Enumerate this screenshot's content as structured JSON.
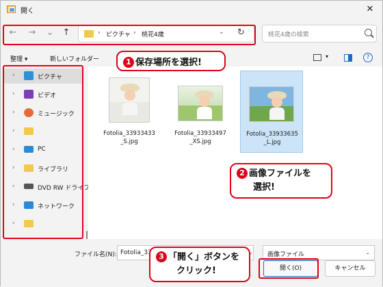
{
  "window": {
    "title": "開く",
    "close_glyph": "✕"
  },
  "nav": {
    "back": "←",
    "forward": "→",
    "recent": "⌄",
    "up": "↑"
  },
  "address": {
    "segments": [
      "ピクチャ",
      "桃花4歳"
    ],
    "separator": "›",
    "dropdown": "⌄",
    "refresh": "↻"
  },
  "search": {
    "placeholder": "桃花4歳の検索"
  },
  "toolbar": {
    "organize": "整理 ▾",
    "new_folder": "新しいフォルダー",
    "view_dropdown": "▾",
    "help": "?"
  },
  "sidebar": {
    "items": [
      {
        "label": "ピクチャ",
        "icon": "pictures-icon",
        "color": "#2f8fd8",
        "selected": true
      },
      {
        "label": "ビデオ",
        "icon": "videos-icon",
        "color": "#7a3fb6"
      },
      {
        "label": "ミュージック",
        "icon": "music-icon",
        "color": "#e56b3a"
      },
      {
        "label": "",
        "icon": "folder-icon",
        "color": "#f1c94d"
      },
      {
        "label": "PC",
        "icon": "pc-icon",
        "color": "#2b8ad3"
      },
      {
        "label": "ライブラリ",
        "icon": "library-icon",
        "color": "#f1c94d"
      },
      {
        "label": "DVD RW ドライブ",
        "icon": "dvd-drive-icon",
        "color": "#555555"
      },
      {
        "label": "ネットワーク",
        "icon": "network-icon",
        "color": "#2b8ad3"
      },
      {
        "label": "",
        "icon": "folder-icon",
        "color": "#f1c94d"
      }
    ],
    "chevron": "›"
  },
  "files": [
    {
      "name_line1": "Fotolia_33933433",
      "name_line2": "_S.jpg",
      "selected": false
    },
    {
      "name_line1": "Fotolia_33933497",
      "name_line2": "_XS.jpg",
      "selected": false
    },
    {
      "name_line1": "Fotolia_33933635",
      "name_line2": "_L.jpg",
      "selected": true
    }
  ],
  "bottom": {
    "filename_label": "ファイル名(N):",
    "filename_value": "Fotolia_33",
    "filetype": "画像ファイル",
    "dropdown": "⌄",
    "open_label": "開く(O)",
    "cancel_label": "キャンセル"
  },
  "callouts": {
    "step1_num": "1",
    "step1_text": "保存場所を選択!",
    "step2_num": "2",
    "step2_line1": "画像ファイルを",
    "step2_line2": "選択!",
    "step3_num": "3",
    "step3_line1": "「開く」ボタンを",
    "step3_line2": "クリック!"
  },
  "colors": {
    "accent": "#1c6bc2",
    "callout_red": "#e0001a",
    "selection": "#cce4f7"
  }
}
